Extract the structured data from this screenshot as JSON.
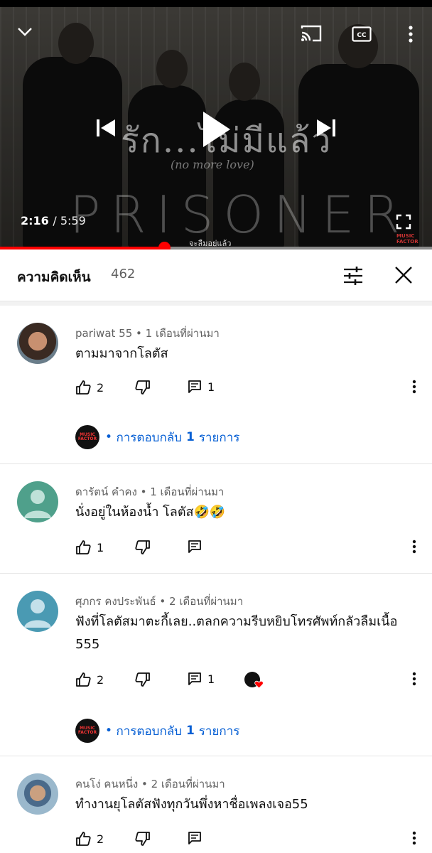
{
  "video": {
    "title_art": "รัก...ไม่มีแล้ว",
    "subtitle_art": "(no more love)",
    "band_art": "PRISONER",
    "caption": "จะลืมอยู่แล้ว",
    "brand": "MUSIC FACTOR",
    "current_time": "2:16",
    "duration": "5:59",
    "progress": 0.38,
    "accent_color": "#ff0000"
  },
  "comments_header": {
    "title": "ความคิดเห็น",
    "count": "462"
  },
  "comments": [
    {
      "author": "pariwat 55",
      "time": "1 เดือนที่ผ่านมา",
      "text": "ตามมาจากโลตัส",
      "likes": "2",
      "replies": "1",
      "reply_link": {
        "prefix": "การตอบกลับ",
        "count": "1",
        "suffix": "รายการ"
      },
      "reply_avatar": "MUSIC FACTOR"
    },
    {
      "author": "ดารัตน์ คำคง",
      "time": "1 เดือนที่ผ่านมา",
      "text": "นั่งอยู่ในห้องน้ำ โลตัส🤣🤣",
      "likes": "1",
      "replies": ""
    },
    {
      "author": "ศุภกร คงประพันธ์",
      "time": "2 เดือนที่ผ่านมา",
      "text": "ฟังที่โลตัสมาตะกี้เลย..ตลกความรีบหยิบโทรศัพท์กลัวลืมเนื้อ 555",
      "likes": "2",
      "replies": "1",
      "reply_link": {
        "prefix": "การตอบกลับ",
        "count": "1",
        "suffix": "รายการ"
      },
      "reply_avatar": "MUSIC FACTOR"
    },
    {
      "author": "คนโง่ คนหนึ่ง",
      "time": "2 เดือนที่ผ่านมา",
      "text": "ทำงานยุโลตัสฟังทุกวันพึ่งหาชื่อเพลงเจอ55",
      "likes": "2",
      "replies": ""
    }
  ]
}
